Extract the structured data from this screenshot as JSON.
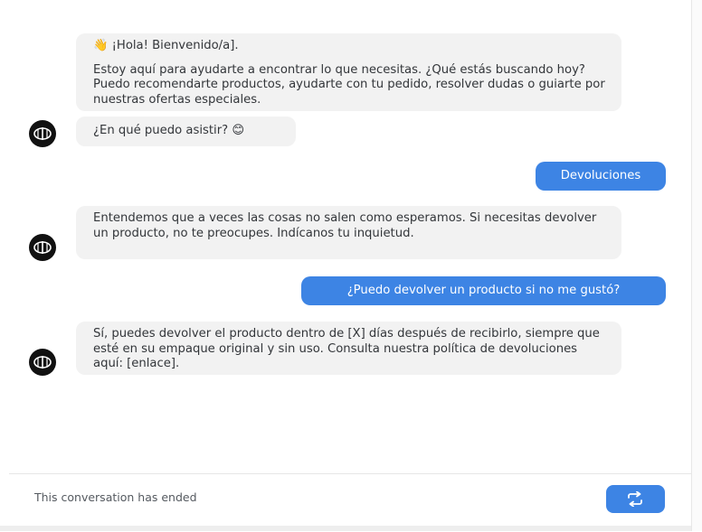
{
  "messages": {
    "welcome_emoji": "👋",
    "welcome_greeting": "¡Hola! Bienvenido/a].",
    "welcome_body": "Estoy aquí para ayudarte a encontrar lo que necesitas. ¿Qué estás buscando hoy? Puedo recomendarte productos, ayudarte con tu pedido, resolver dudas o guiarte por nuestras ofertas especiales.",
    "ask_help": "¿En qué puedo asistir?",
    "ask_help_emoji": "😊",
    "user_option": "Devoluciones",
    "bot_returns_reply": "Entendemos que a veces las cosas no salen como esperamos. Si necesitas devolver un producto, no te preocupes. Indícanos tu inquietud.",
    "user_question": "¿Puedo devolver un producto si no me gustó?",
    "bot_policy_reply": "Sí, puedes devolver el producto dentro de [X] días después de recibirlo, siempre que esté en su empaque original y sin uso. Consulta nuestra política de devoluciones aquí: [enlace]."
  },
  "footer": {
    "status_text": "This conversation has ended",
    "restart_icon": "refresh-icon"
  },
  "colors": {
    "bot_bubble": "#f2f2f2",
    "user_bubble": "#3d84e4",
    "avatar": "#111111"
  }
}
